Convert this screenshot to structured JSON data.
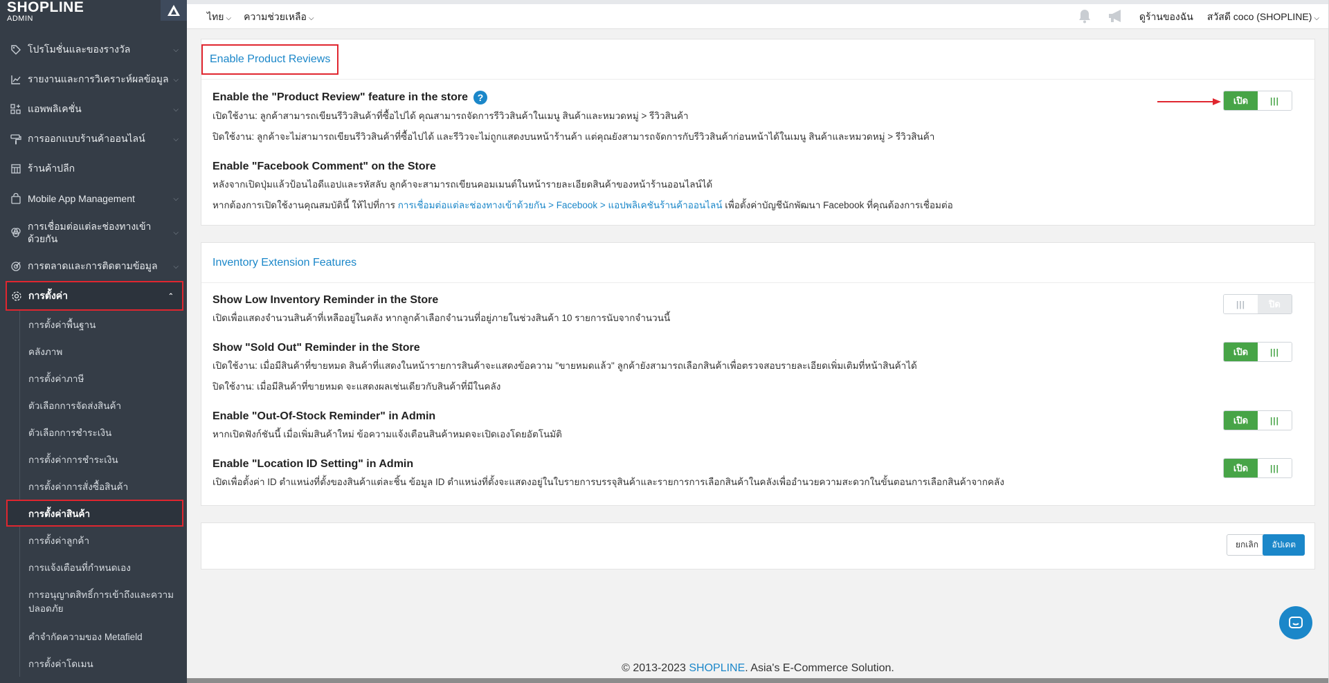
{
  "brand": {
    "name": "SHOPLINE",
    "sub": "ADMIN"
  },
  "sidebar": {
    "items": [
      {
        "label": "โปรโมชั่นและของรางวัล",
        "icon": "tag-icon"
      },
      {
        "label": "รายงานและการวิเคราะห์ผลข้อมูล",
        "icon": "chart-icon"
      },
      {
        "label": "แอพพลิเคชั่น",
        "icon": "apps-icon"
      },
      {
        "label": "การออกแบบร้านค้าออนไลน์",
        "icon": "brush-icon"
      },
      {
        "label": "ร้านค้าปลีก",
        "icon": "store-icon"
      },
      {
        "label": "Mobile App Management",
        "icon": "bag-icon"
      },
      {
        "label": "การเชื่อมต่อแต่ละช่องทางเข้าด้วยกัน",
        "icon": "connect-icon"
      },
      {
        "label": "การตลาดและการติดตามข้อมูล",
        "icon": "target-icon"
      },
      {
        "label": "การตั้งค่า",
        "icon": "gear-icon"
      }
    ],
    "subitems": [
      "การตั้งค่าพื้นฐาน",
      "คลังภาพ",
      "การตั้งค่าภาษี",
      "ตัวเลือกการจัดส่งสินค้า",
      "ตัวเลือกการชำระเงิน",
      "การตั้งค่าการชำระเงิน",
      "การตั้งค่าการสั่งซื้อสินค้า",
      "การตั้งค่าสินค้า",
      "การตั้งค่าลูกค้า",
      "การแจ้งเตือนที่กำหนดเอง",
      "การอนุญาตสิทธิ์การเข้าถึงและความปลอดภัย",
      "คำจำกัดความของ Metafield",
      "การตั้งค่าโดเมน"
    ]
  },
  "topbar": {
    "language": "ไทย",
    "help": "ความช่วยเหลือ",
    "view_store": "ดูร้านของฉัน",
    "greeting": "สวัสดี coco (SHOPLINE)"
  },
  "review_card": {
    "title": "Enable Product Reviews",
    "settings": [
      {
        "title": "Enable the \"Product Review\" feature in the store",
        "lines": [
          "เปิดใช้งาน: ลูกค้าสามารถเขียนรีวิวสินค้าที่ซื้อไปได้ คุณสามารถจัดการรีวิวสินค้าในเมนู สินค้าและหมวดหมู่ > รีวิวสินค้า",
          "ปิดใช้งาน: ลูกค้าจะไม่สามารถเขียนรีวิวสินค้าที่ซื้อไปได้ และรีวิวจะไม่ถูกแสดงบนหน้าร้านค้า แต่คุณยังสามารถจัดการกับรีวิวสินค้าก่อนหน้าได้ในเมนู สินค้าและหมวดหมู่ > รีวิวสินค้า"
        ],
        "toggle_on": true
      },
      {
        "title": "Enable \"Facebook Comment\" on the Store",
        "line1": "หลังจากเปิดปุ่มแล้วป้อนไอดีแอปและรหัสลับ ลูกค้าจะสามารถเขียนคอมเมนต์ในหน้ารายละเอียดสินค้าของหน้าร้านออนไลน์ได้",
        "line2_pre": "หากต้องการเปิดใช้งานคุณสมบัตินี้ ให้ไปที่การ ",
        "line2_link": "การเชื่อมต่อแต่ละช่องทางเข้าด้วยกัน > Facebook > แอปพลิเคชันร้านค้าออนไลน์",
        "line2_post": " เพื่อตั้งค่าบัญชีนักพัฒนา Facebook ที่คุณต้องการเชื่อมต่อ"
      }
    ]
  },
  "inventory_card": {
    "title": "Inventory Extension Features",
    "settings": [
      {
        "title": "Show Low Inventory Reminder in the Store",
        "lines": [
          "เปิดเพื่อแสดงจำนวนสินค้าที่เหลืออยู่ในคลัง หากลูกค้าเลือกจำนวนที่อยู่ภายในช่วงสินค้า 10 รายการนับจากจำนวนนี้"
        ],
        "toggle_on": false
      },
      {
        "title": "Show \"Sold Out\" Reminder in the Store",
        "lines": [
          "เปิดใช้งาน: เมื่อมีสินค้าที่ขายหมด สินค้าที่แสดงในหน้ารายการสินค้าจะแสดงข้อความ \"ขายหมดแล้ว\" ลูกค้ายังสามารถเลือกสินค้าเพื่อตรวจสอบรายละเอียดเพิ่มเติมที่หน้าสินค้าได้",
          "ปิดใช้งาน: เมื่อมีสินค้าที่ขายหมด จะแสดงผลเช่นเดียวกับสินค้าที่มีในคลัง"
        ],
        "toggle_on": true
      },
      {
        "title": "Enable \"Out-Of-Stock Reminder\" in Admin",
        "lines": [
          "หากเปิดฟังก์ชันนี้ เมื่อเพิ่มสินค้าใหม่ ข้อความแจ้งเตือนสินค้าหมดจะเปิดเองโดยอัตโนมัติ"
        ],
        "toggle_on": true
      },
      {
        "title": "Enable \"Location ID Setting\" in Admin",
        "lines": [
          "เปิดเพื่อตั้งค่า ID ตำแหน่งที่ตั้งของสินค้าแต่ละชิ้น ข้อมูล ID ตำแหน่งที่ตั้งจะแสดงอยู่ในใบรายการบรรจุสินค้าและรายการการเลือกสินค้าในคลังเพื่ออำนวยความสะดวกในขั้นตอนการเลือกสินค้าจากคลัง"
        ],
        "toggle_on": true
      }
    ]
  },
  "toggle": {
    "on_label": "เปิด",
    "off_label": "ปิด",
    "grip": "|||"
  },
  "actions": {
    "cancel": "ยกเลิก",
    "update": "อัปเดต"
  },
  "footer": {
    "pre": "© 2013-2023 ",
    "brand": "SHOPLINE",
    "post": ". Asia's E-Commerce Solution."
  },
  "colors": {
    "accent": "#1b87c9",
    "toggle_on": "#47a447",
    "highlight": "#e0262f",
    "sidebar": "#353d47"
  }
}
